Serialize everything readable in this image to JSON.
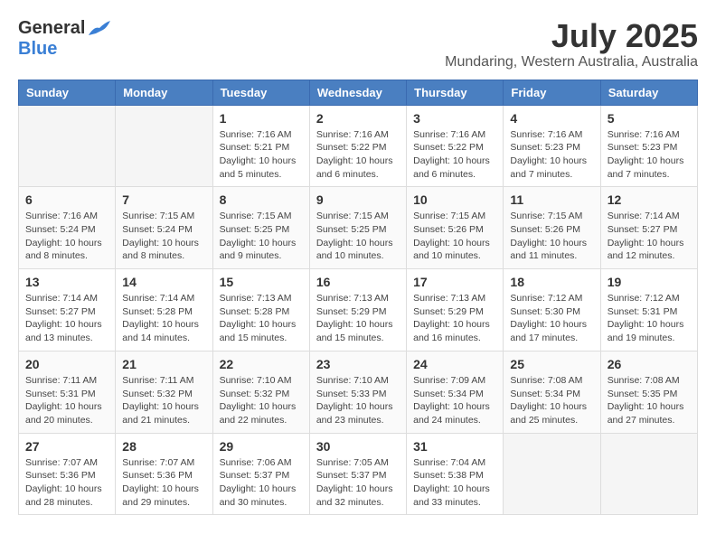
{
  "header": {
    "logo_general": "General",
    "logo_blue": "Blue",
    "title": "July 2025",
    "subtitle": "Mundaring, Western Australia, Australia"
  },
  "weekdays": [
    "Sunday",
    "Monday",
    "Tuesday",
    "Wednesday",
    "Thursday",
    "Friday",
    "Saturday"
  ],
  "weeks": [
    [
      {
        "day": "",
        "info": ""
      },
      {
        "day": "",
        "info": ""
      },
      {
        "day": "1",
        "info": "Sunrise: 7:16 AM\nSunset: 5:21 PM\nDaylight: 10 hours and 5 minutes."
      },
      {
        "day": "2",
        "info": "Sunrise: 7:16 AM\nSunset: 5:22 PM\nDaylight: 10 hours and 6 minutes."
      },
      {
        "day": "3",
        "info": "Sunrise: 7:16 AM\nSunset: 5:22 PM\nDaylight: 10 hours and 6 minutes."
      },
      {
        "day": "4",
        "info": "Sunrise: 7:16 AM\nSunset: 5:23 PM\nDaylight: 10 hours and 7 minutes."
      },
      {
        "day": "5",
        "info": "Sunrise: 7:16 AM\nSunset: 5:23 PM\nDaylight: 10 hours and 7 minutes."
      }
    ],
    [
      {
        "day": "6",
        "info": "Sunrise: 7:16 AM\nSunset: 5:24 PM\nDaylight: 10 hours and 8 minutes."
      },
      {
        "day": "7",
        "info": "Sunrise: 7:15 AM\nSunset: 5:24 PM\nDaylight: 10 hours and 8 minutes."
      },
      {
        "day": "8",
        "info": "Sunrise: 7:15 AM\nSunset: 5:25 PM\nDaylight: 10 hours and 9 minutes."
      },
      {
        "day": "9",
        "info": "Sunrise: 7:15 AM\nSunset: 5:25 PM\nDaylight: 10 hours and 10 minutes."
      },
      {
        "day": "10",
        "info": "Sunrise: 7:15 AM\nSunset: 5:26 PM\nDaylight: 10 hours and 10 minutes."
      },
      {
        "day": "11",
        "info": "Sunrise: 7:15 AM\nSunset: 5:26 PM\nDaylight: 10 hours and 11 minutes."
      },
      {
        "day": "12",
        "info": "Sunrise: 7:14 AM\nSunset: 5:27 PM\nDaylight: 10 hours and 12 minutes."
      }
    ],
    [
      {
        "day": "13",
        "info": "Sunrise: 7:14 AM\nSunset: 5:27 PM\nDaylight: 10 hours and 13 minutes."
      },
      {
        "day": "14",
        "info": "Sunrise: 7:14 AM\nSunset: 5:28 PM\nDaylight: 10 hours and 14 minutes."
      },
      {
        "day": "15",
        "info": "Sunrise: 7:13 AM\nSunset: 5:28 PM\nDaylight: 10 hours and 15 minutes."
      },
      {
        "day": "16",
        "info": "Sunrise: 7:13 AM\nSunset: 5:29 PM\nDaylight: 10 hours and 15 minutes."
      },
      {
        "day": "17",
        "info": "Sunrise: 7:13 AM\nSunset: 5:29 PM\nDaylight: 10 hours and 16 minutes."
      },
      {
        "day": "18",
        "info": "Sunrise: 7:12 AM\nSunset: 5:30 PM\nDaylight: 10 hours and 17 minutes."
      },
      {
        "day": "19",
        "info": "Sunrise: 7:12 AM\nSunset: 5:31 PM\nDaylight: 10 hours and 19 minutes."
      }
    ],
    [
      {
        "day": "20",
        "info": "Sunrise: 7:11 AM\nSunset: 5:31 PM\nDaylight: 10 hours and 20 minutes."
      },
      {
        "day": "21",
        "info": "Sunrise: 7:11 AM\nSunset: 5:32 PM\nDaylight: 10 hours and 21 minutes."
      },
      {
        "day": "22",
        "info": "Sunrise: 7:10 AM\nSunset: 5:32 PM\nDaylight: 10 hours and 22 minutes."
      },
      {
        "day": "23",
        "info": "Sunrise: 7:10 AM\nSunset: 5:33 PM\nDaylight: 10 hours and 23 minutes."
      },
      {
        "day": "24",
        "info": "Sunrise: 7:09 AM\nSunset: 5:34 PM\nDaylight: 10 hours and 24 minutes."
      },
      {
        "day": "25",
        "info": "Sunrise: 7:08 AM\nSunset: 5:34 PM\nDaylight: 10 hours and 25 minutes."
      },
      {
        "day": "26",
        "info": "Sunrise: 7:08 AM\nSunset: 5:35 PM\nDaylight: 10 hours and 27 minutes."
      }
    ],
    [
      {
        "day": "27",
        "info": "Sunrise: 7:07 AM\nSunset: 5:36 PM\nDaylight: 10 hours and 28 minutes."
      },
      {
        "day": "28",
        "info": "Sunrise: 7:07 AM\nSunset: 5:36 PM\nDaylight: 10 hours and 29 minutes."
      },
      {
        "day": "29",
        "info": "Sunrise: 7:06 AM\nSunset: 5:37 PM\nDaylight: 10 hours and 30 minutes."
      },
      {
        "day": "30",
        "info": "Sunrise: 7:05 AM\nSunset: 5:37 PM\nDaylight: 10 hours and 32 minutes."
      },
      {
        "day": "31",
        "info": "Sunrise: 7:04 AM\nSunset: 5:38 PM\nDaylight: 10 hours and 33 minutes."
      },
      {
        "day": "",
        "info": ""
      },
      {
        "day": "",
        "info": ""
      }
    ]
  ]
}
